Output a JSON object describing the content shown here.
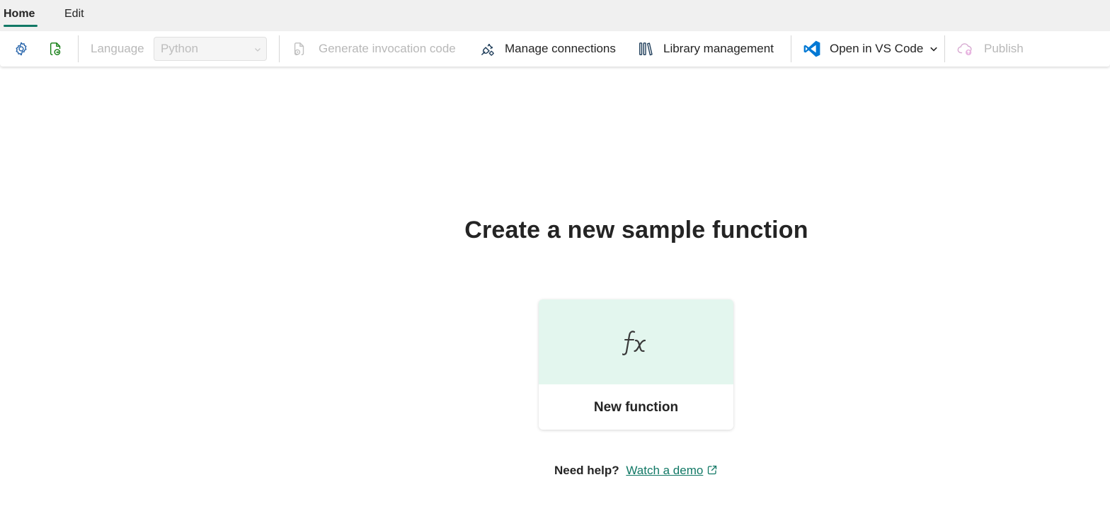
{
  "tabs": [
    {
      "label": "Home",
      "active": true
    },
    {
      "label": "Edit",
      "active": false
    }
  ],
  "toolbar": {
    "language_label": "Language",
    "language_value": "Python",
    "generate_label": "Generate invocation code",
    "manage_label": "Manage connections",
    "library_label": "Library management",
    "vscode_label": "Open in VS Code",
    "publish_label": "Publish"
  },
  "icons": {
    "settings": "gear-icon",
    "refresh": "file-refresh-icon",
    "generate": "file-code-icon",
    "manage": "plug-settings-icon",
    "library": "library-books-icon",
    "vscode": "vscode-logo-icon",
    "publish": "cloud-upload-icon",
    "fx": "function-fx-icon",
    "external": "external-link-icon"
  },
  "main": {
    "title": "Create a new sample function",
    "card_label": "New function",
    "help_text": "Need help?",
    "help_link": "Watch a demo"
  },
  "colors": {
    "accent": "#117865",
    "card_top": "#e3f6ee",
    "vscode_blue": "#0065a9",
    "disabled": "#b8b8b8"
  }
}
